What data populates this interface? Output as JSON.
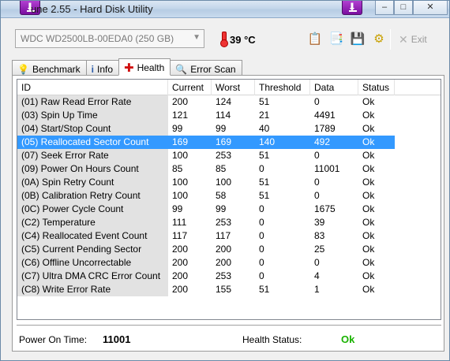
{
  "window": {
    "title": "une 2.55 - Hard Disk Utility",
    "controls": [
      "minimize",
      "maximize",
      "close"
    ]
  },
  "toolbar": {
    "drive": "WDC WD2500LB-00EDA0 (250 GB)",
    "temperature": "39 °C",
    "icons": [
      "copy-icon",
      "copy-all-icon",
      "save-icon",
      "options-icon"
    ],
    "exit_label": "Exit"
  },
  "tabs": [
    {
      "label": "Benchmark",
      "icon": "bulb-icon"
    },
    {
      "label": "Info",
      "icon": "info-icon"
    },
    {
      "label": "Health",
      "icon": "health-cross-icon",
      "active": true
    },
    {
      "label": "Error Scan",
      "icon": "magnifier-icon"
    }
  ],
  "columns": [
    "ID",
    "Current",
    "Worst",
    "Threshold",
    "Data",
    "Status"
  ],
  "rows": [
    [
      "(01) Raw Read Error Rate",
      "200",
      "124",
      "51",
      "0",
      "Ok"
    ],
    [
      "(03) Spin Up Time",
      "121",
      "114",
      "21",
      "4491",
      "Ok"
    ],
    [
      "(04) Start/Stop Count",
      "99",
      "99",
      "40",
      "1789",
      "Ok"
    ],
    [
      "(05) Reallocated Sector Count",
      "169",
      "169",
      "140",
      "492",
      "Ok"
    ],
    [
      "(07) Seek Error Rate",
      "100",
      "253",
      "51",
      "0",
      "Ok"
    ],
    [
      "(09) Power On Hours Count",
      "85",
      "85",
      "0",
      "11001",
      "Ok"
    ],
    [
      "(0A) Spin Retry Count",
      "100",
      "100",
      "51",
      "0",
      "Ok"
    ],
    [
      "(0B) Calibration Retry Count",
      "100",
      "58",
      "51",
      "0",
      "Ok"
    ],
    [
      "(0C) Power Cycle Count",
      "99",
      "99",
      "0",
      "1675",
      "Ok"
    ],
    [
      "(C2) Temperature",
      "111",
      "253",
      "0",
      "39",
      "Ok"
    ],
    [
      "(C4) Reallocated Event Count",
      "117",
      "117",
      "0",
      "83",
      "Ok"
    ],
    [
      "(C5) Current Pending Sector",
      "200",
      "200",
      "0",
      "25",
      "Ok"
    ],
    [
      "(C6) Offline Uncorrectable",
      "200",
      "200",
      "0",
      "0",
      "Ok"
    ],
    [
      "(C7) Ultra DMA CRC Error Count",
      "200",
      "253",
      "0",
      "4",
      "Ok"
    ],
    [
      "(C8) Write Error Rate",
      "200",
      "155",
      "51",
      "1",
      "Ok"
    ]
  ],
  "selected_row": 3,
  "footer": {
    "power_on_label": "Power On Time:",
    "power_on_value": "11001",
    "health_label": "Health Status:",
    "health_value": "Ok",
    "health_color": "#19b200"
  }
}
